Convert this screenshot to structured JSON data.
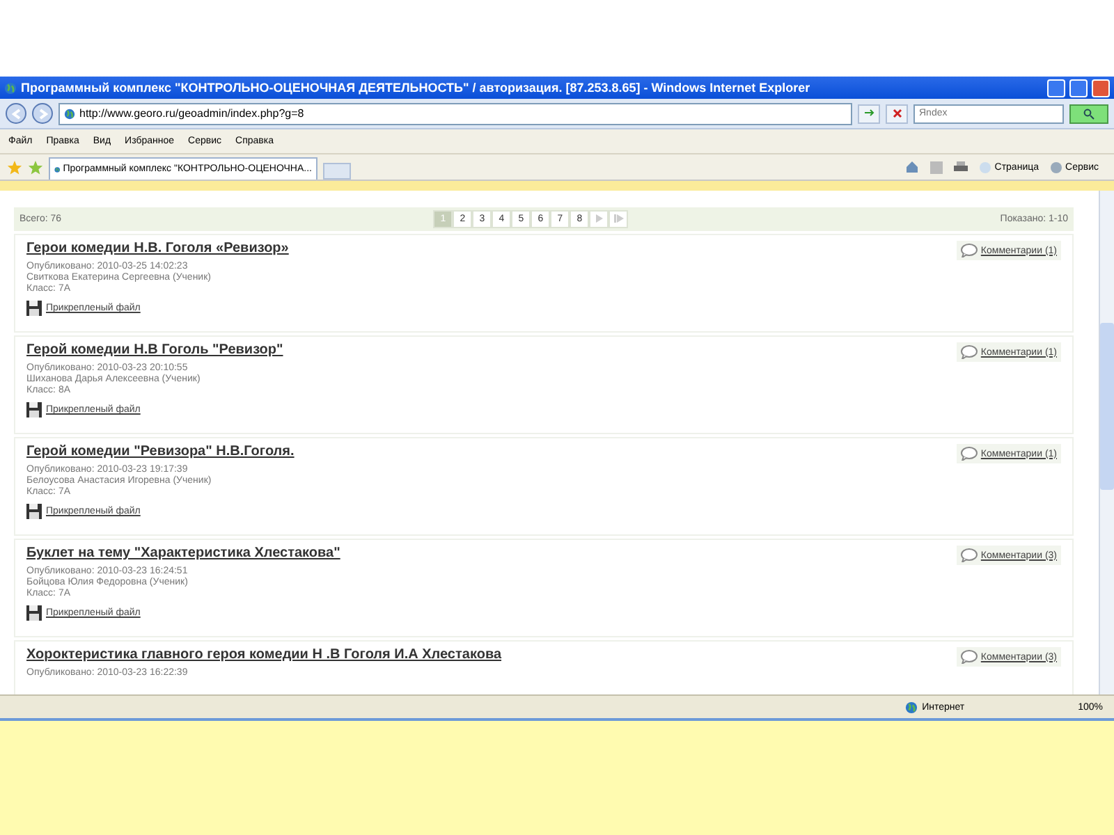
{
  "window": {
    "title": "Программный комплекс \"КОНТРОЛЬНО-ОЦЕНОЧНАЯ ДЕЯТЕЛЬНОСТЬ\" / авторизация. [87.253.8.65] - Windows Internet Explorer"
  },
  "address": {
    "url": "http://www.georo.ru/geoadmin/index.php?g=8"
  },
  "search": {
    "placeholder": "Яndex"
  },
  "menu": [
    "Файл",
    "Правка",
    "Вид",
    "Избранное",
    "Сервис",
    "Справка"
  ],
  "tab": {
    "title": "Программный комплекс \"КОНТРОЛЬНО-ОЦЕНОЧНА..."
  },
  "toolbar": [
    "Страница",
    "Сервис"
  ],
  "pager": {
    "total": "Всего: 76",
    "shown": "Показано: 1-10",
    "pages": [
      {
        "label": "1",
        "selected": true
      },
      {
        "label": "2",
        "selected": false
      },
      {
        "label": "3",
        "selected": false
      },
      {
        "label": "4",
        "selected": false
      },
      {
        "label": "5",
        "selected": false
      },
      {
        "label": "6",
        "selected": false
      },
      {
        "label": "7",
        "selected": false
      },
      {
        "label": "8",
        "selected": false
      }
    ]
  },
  "posts": [
    {
      "title": "Герои комедии Н.В. Гоголя «Ревизор»",
      "published": "Опубликовано: 2010-03-25 14:02:23",
      "author": "Свиткова Екатерина Сергеевна (Ученик)",
      "class": "Класс: 7А",
      "attachment": "Прикрепленый файл",
      "comments": "Комментарии (1)"
    },
    {
      "title": "Герой комедии Н.В Гоголь \"Ревизор\"",
      "published": "Опубликовано: 2010-03-23 20:10:55",
      "author": "Шиханова Дарья Алексеевна (Ученик)",
      "class": "Класс: 8А",
      "attachment": "Прикрепленый файл",
      "comments": "Комментарии (1)"
    },
    {
      "title": "Герой комедии \"Ревизора\" Н.В.Гоголя.",
      "published": "Опубликовано: 2010-03-23 19:17:39",
      "author": "Белоусова Анастасия Игоревна (Ученик)",
      "class": "Класс: 7А",
      "attachment": "Прикрепленый файл",
      "comments": "Комментарии (1)"
    },
    {
      "title": "Буклет на тему \"Характеристика Хлестакова\"",
      "published": "Опубликовано: 2010-03-23 16:24:51",
      "author": "Бойцова Юлия Федоровна (Ученик)",
      "class": "Класс: 7А",
      "attachment": "Прикрепленый файл",
      "comments": "Комментарии (3)"
    },
    {
      "title": "Хороктеристика главного героя комедии Н .В Гоголя И.А Хлестакова",
      "published": "Опубликовано: 2010-03-23 16:22:39",
      "comments": "Комментарии (3)"
    }
  ],
  "status": {
    "zone": "Интернет",
    "zoom": "100%"
  }
}
